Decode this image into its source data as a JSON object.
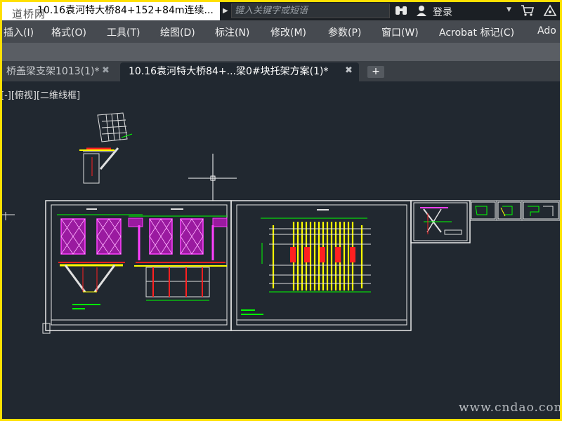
{
  "window": {
    "title": "10.16袁河特大桥84+152+84m连续...",
    "watermark_top": "道桥网"
  },
  "search": {
    "placeholder": "键入关键字或短语"
  },
  "toolbar": {
    "binoculars_icon": "binoculars-icon",
    "user_icon": "user-icon",
    "login_label": "登录",
    "cart_icon": "cart-icon",
    "help_icon": "help-icon"
  },
  "menu": {
    "items": [
      {
        "label": "插入(I)"
      },
      {
        "label": "格式(O)"
      },
      {
        "label": "工具(T)"
      },
      {
        "label": "绘图(D)"
      },
      {
        "label": "标注(N)"
      },
      {
        "label": "修改(M)"
      },
      {
        "label": "参数(P)"
      },
      {
        "label": "窗口(W)"
      },
      {
        "label": "Acrobat 标记(C)"
      },
      {
        "label": "Ado"
      }
    ]
  },
  "tabs": [
    {
      "label": "桥盖梁支架1013(1)*",
      "active": false
    },
    {
      "label": "10.16袁河特大桥84+...梁0#块托架方案(1)*",
      "active": true
    }
  ],
  "new_tab_label": "+",
  "viewport": {
    "view_label": "[-][俯视][二维线框]",
    "background": "#212830"
  },
  "watermark_bottom": "www.cndao.com",
  "colors": {
    "border": "#ffe000",
    "menubar": "#464a50",
    "title_bg": "#1b1f24"
  }
}
